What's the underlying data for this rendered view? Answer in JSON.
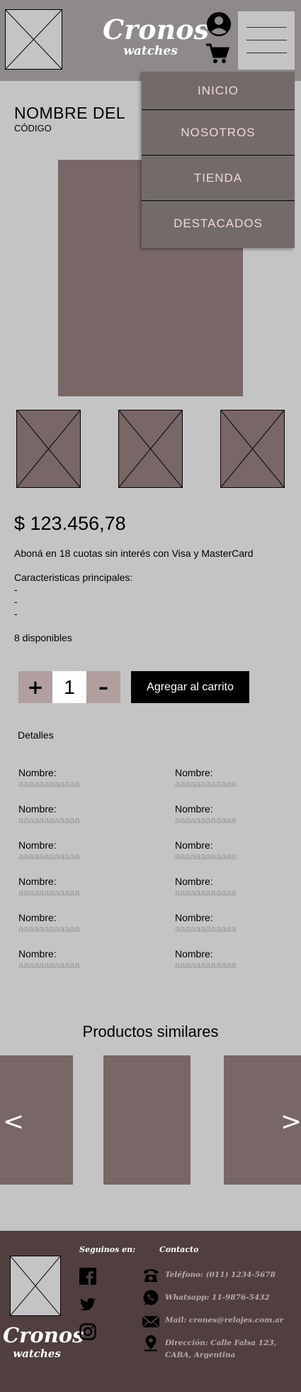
{
  "header": {
    "brand_name": "Cronos",
    "brand_sub": "watches"
  },
  "nav": {
    "items": [
      {
        "label": "INICIO"
      },
      {
        "label": "NOSOTROS"
      },
      {
        "label": "TIENDA"
      },
      {
        "label": "DESTACADOS"
      }
    ]
  },
  "product": {
    "title": "NOMBRE DEL",
    "code": "CÓDIGO",
    "price": "$ 123.456,78",
    "installments": "Aboná en 18 cuotas sin interés con Visa y MasterCard",
    "features_title": "Caracteristicas principales:",
    "features": [
      "-",
      "-",
      "-"
    ],
    "stock": "8 disponibles"
  },
  "purchase": {
    "plus": "+",
    "quantity": "1",
    "minus": "–",
    "add_to_cart": "Agregar al carrito"
  },
  "details": {
    "title": "Detalles",
    "specs": [
      {
        "label": "Nombre:",
        "value": "aaaaaaaaaaaa"
      },
      {
        "label": "Nombre:",
        "value": "aaaaaaaaaaaa"
      },
      {
        "label": "Nombre:",
        "value": "aaaaaaaaaaaa"
      },
      {
        "label": "Nombre:",
        "value": "aaaaaaaaaaaa"
      },
      {
        "label": "Nombre:",
        "value": "aaaaaaaaaaaa"
      },
      {
        "label": "Nombre:",
        "value": "aaaaaaaaaaaa"
      },
      {
        "label": "Nombre:",
        "value": "aaaaaaaaaaaa"
      },
      {
        "label": "Nombre:",
        "value": "aaaaaaaaaaaa"
      },
      {
        "label": "Nombre:",
        "value": "aaaaaaaaaaaa"
      },
      {
        "label": "Nombre:",
        "value": "aaaaaaaaaaaa"
      },
      {
        "label": "Nombre:",
        "value": "aaaaaaaaaaaa"
      },
      {
        "label": "Nombre:",
        "value": "aaaaaaaaaaaa"
      }
    ]
  },
  "similar": {
    "title": "Productos similares",
    "prev": "<",
    "next": ">"
  },
  "footer": {
    "brand_name": "Cronos",
    "brand_sub": "watches",
    "follow_title": "Seguinos en:",
    "social": [
      "facebook-icon",
      "twitter-icon",
      "instagram-icon"
    ],
    "contact_title": "Contacto",
    "phone": "Teléfono: (011) 1234-5678",
    "whatsapp": "Whatsapp: 11-9876-5432",
    "mail": "Mail: crones@relojes.com.ar",
    "address": "Dirección: Calle Falsa 123, CABA, Argentina"
  },
  "colors": {
    "header_bg": "#8d8a89",
    "page_bg": "#c4c4c4",
    "product_placeholder": "#786766",
    "dropdown_bg": "#726b6a",
    "qty_button": "#b09f9e",
    "footer_bg": "#513e3f"
  }
}
